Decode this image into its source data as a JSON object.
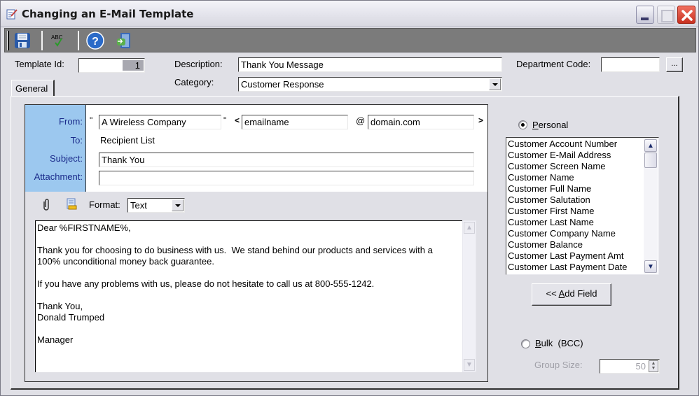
{
  "window": {
    "title": "Changing an E-Mail Template"
  },
  "toolbar": {
    "buttons": [
      {
        "name": "save",
        "icon": "floppy-disk-icon"
      },
      {
        "name": "spell-check",
        "icon": "abc-check-icon",
        "icon_text": "ABC"
      },
      {
        "name": "help",
        "icon": "question-mark-icon",
        "icon_text": "?"
      },
      {
        "name": "exit",
        "icon": "exit-door-icon"
      }
    ]
  },
  "header": {
    "template_id_label": "Template Id:",
    "template_id_value": "1",
    "description_label": "Description:",
    "description_value": "Thank You Message",
    "category_label": "Category:",
    "category_value": "Customer Response",
    "department_code_label": "Department Code:",
    "department_code_value": "",
    "department_browse_label": "..."
  },
  "tabs": [
    {
      "label": "General",
      "active": true
    }
  ],
  "email": {
    "from_label": "From:",
    "to_label": "To:",
    "subject_label": "Subject:",
    "attachment_label": "Attachment:",
    "open_quote": "\"",
    "close_quote": "\"",
    "lt": "<",
    "at": "@",
    "gt": ">",
    "from_name": "A Wireless Company",
    "from_user": "emailname",
    "from_domain": "domain.com",
    "to_value": "Recipient List",
    "subject_value": "Thank You",
    "attachment_value": "",
    "format_label": "Format:",
    "format_value": "Text",
    "body": "Dear %FIRSTNAME%,\n\nThank you for choosing to do business with us.  We stand behind our products and services with a\n100% unconditional money back guarantee.\n\nIf you have any problems with us, please do not hesitate to call us at 800-555-1242.\n\nThank You,\nDonald Trumped\n\nManager"
  },
  "fields_panel": {
    "personal_label_prefix": "",
    "personal_label_underline": "P",
    "personal_label_rest": "ersonal",
    "personal_selected": true,
    "field_list": [
      "Customer Account Number",
      "Customer E-Mail Address",
      "Customer Screen Name",
      "Customer Name",
      "Customer Full Name",
      "Customer Salutation",
      "Customer First Name",
      "Customer Last Name",
      "Customer Company Name",
      "Customer Balance",
      "Customer Last Payment Amt",
      "Customer Last Payment Date"
    ],
    "add_field_prefix": "<< ",
    "add_field_underline": "A",
    "add_field_rest": "dd Field",
    "bulk_label_underline": "B",
    "bulk_label_rest": "ulk",
    "bulk_suffix": "(BCC)",
    "bulk_selected": false,
    "group_size_label": "Group Size:",
    "group_size_value": "50"
  },
  "colors": {
    "header_label_bg": "#9cc8ef",
    "header_label_text": "#1a2a8a",
    "toolbar_bg": "#7b7b7b",
    "window_bg": "#e0e0e6",
    "close_button": "#d84030"
  }
}
